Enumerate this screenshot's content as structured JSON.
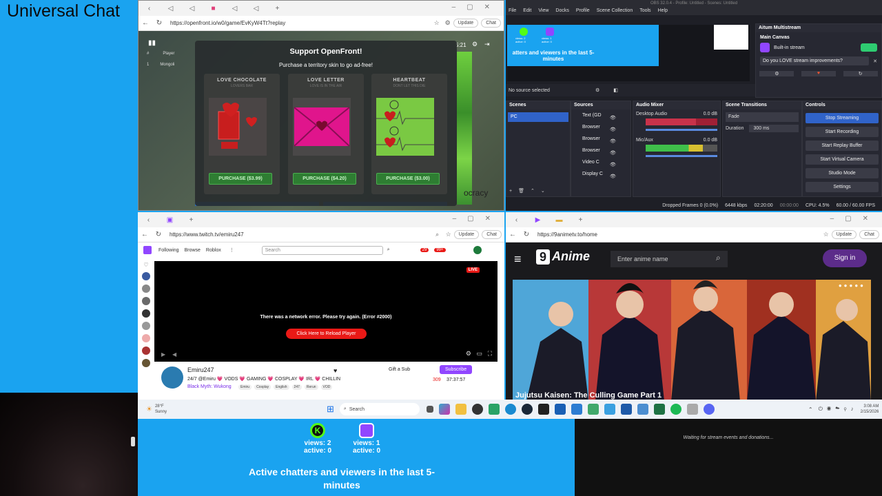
{
  "overlay": {
    "title": "Universal Chat",
    "waiting_text": "Waiting for stream events and donations...",
    "stats": [
      {
        "platform": "kick",
        "views": "views: 2",
        "active": "active: 0",
        "color": "#53fc18"
      },
      {
        "platform": "twitch",
        "views": "views: 1",
        "active": "active: 0",
        "color": "#9146ff"
      }
    ],
    "active_text": "Active chatters and viewers in the last 5-minutes"
  },
  "openfront": {
    "url": "https://openfront.io/w0/game/EvKyW4Tt?replay",
    "heading": "Support OpenFront!",
    "subheading": "Purchase a territory skin to go ad-free!",
    "timer": "5:21",
    "bg_text": "ocracy",
    "table_head": [
      "#",
      "Player"
    ],
    "table_row": [
      "1",
      "Mongoli"
    ],
    "cards": [
      {
        "title": "LOVE CHOCOLATE",
        "sub": "LOVERS BAR",
        "button": "PURCHASE ($3.99)",
        "color": "#8a2020"
      },
      {
        "title": "LOVE LETTER",
        "sub": "LOVE IS IN THE AIR",
        "button": "PURCHASE ($4.20)",
        "color": "#e0158c"
      },
      {
        "title": "HEARTBEAT",
        "sub": "DONT LET THIS DIE",
        "button": "PURCHASE ($3.00)",
        "color": "#7ac943"
      }
    ]
  },
  "browser": {
    "update_label": "Update",
    "chat_label": "Chat"
  },
  "obs": {
    "title": "OBS 32.0.4 - Profile: Untitled - Scenes: Untitled",
    "menu": [
      "File",
      "Edit",
      "View",
      "Docks",
      "Profile",
      "Scene Collection",
      "Tools",
      "Help"
    ],
    "preview_text": "atters and viewers in the last 5-minutes",
    "kick_mini": "views: 2 active: 0",
    "twitch_mini": "views: 1 active: 0",
    "no_source": "No source selected",
    "multistream_title": "Aitum Multistream",
    "main_canvas": "Main Canvas",
    "built_in": "Built-in stream",
    "love_text": "Do you LOVE stream improvements?",
    "scenes_title": "Scenes",
    "scene_item": "PC",
    "sources_title": "Sources",
    "sources": [
      "Text (GD",
      "Browser",
      "Browser",
      "Browser",
      "Video C",
      "Display C"
    ],
    "mixer_title": "Audio Mixer",
    "desktop_audio": "Desktop Audio",
    "mic": "Mic/Aux",
    "db": "0.0 dB",
    "transitions_title": "Scene Transitions",
    "fade": "Fade",
    "duration_label": "Duration",
    "duration_value": "300 ms",
    "controls_title": "Controls",
    "controls": [
      "Stop Streaming",
      "Start Recording",
      "Start Replay Buffer",
      "Start Virtual Camera",
      "Studio Mode",
      "Settings"
    ],
    "status": {
      "dropped": "Dropped Frames 0 (0.0%)",
      "kbps": "6448 kbps",
      "live_time": "02:20:00",
      "rec_time": "00:00:00",
      "cpu": "CPU: 4.5%",
      "fps": "60.00 / 60.00 FPS"
    }
  },
  "twitch": {
    "url": "https://www.twitch.tv/emiru247",
    "nav": [
      "Following",
      "Browse",
      "Roblox"
    ],
    "search_placeholder": "Search",
    "badge1": "29",
    "badge2": "99+",
    "live": "LIVE",
    "error": "There was a network error. Please try again. (Error #2000)",
    "reload": "Click Here to Reload Player",
    "channel": "Emiru247",
    "stream_title": "24/7 @Emiru 💗 VODS 💗 GAMING 💗 COSPLAY 💗 IRL 💗 CHILLIN",
    "game": "Black Myth: Wukong",
    "tags": [
      "Emiru",
      "Cosplay",
      "English",
      "247",
      "Rerun",
      "VOD"
    ],
    "gift": "Gift a Sub",
    "subscribe": "Subscribe",
    "viewers": "309",
    "uptime": "37:37:57"
  },
  "anime": {
    "url": "https://9animetv.to/home",
    "brand": "Anime",
    "search_placeholder": "Enter anime name",
    "signin": "Sign in",
    "title": "Jujutsu Kaisen: The Culling Game Part 1"
  },
  "taskbar": {
    "weather_temp": "28°F",
    "weather_desc": "Sunny",
    "search": "Search",
    "time": "3:08 AM",
    "date": "2/15/2026"
  }
}
